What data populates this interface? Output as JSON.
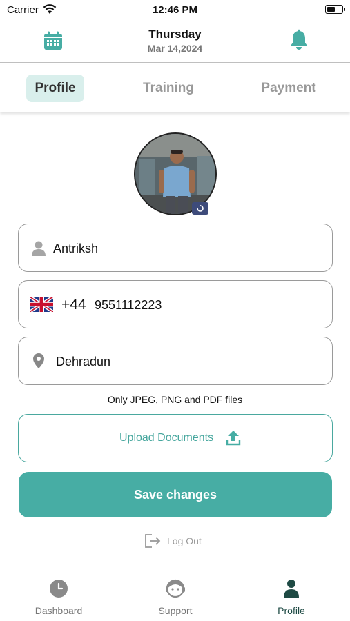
{
  "status_bar": {
    "carrier": "Carrier",
    "time": "12:46 PM"
  },
  "header": {
    "day": "Thursday",
    "date": "Mar 14,2024"
  },
  "tabs": [
    {
      "label": "Profile",
      "active": true
    },
    {
      "label": "Training",
      "active": false
    },
    {
      "label": "Payment",
      "active": false
    }
  ],
  "form": {
    "name": "Antriksh",
    "phone_code": "+44",
    "phone": "9551112223",
    "city": "Dehradun",
    "file_note": "Only JPEG, PNG and PDF files",
    "upload_label": "Upload Documents",
    "save_label": "Save changes",
    "logout_label": "Log Out"
  },
  "bottom_nav": [
    {
      "label": "Dashboard",
      "icon": "clock-icon",
      "active": false
    },
    {
      "label": "Support",
      "icon": "support-agent-icon",
      "active": false
    },
    {
      "label": "Profile",
      "icon": "person-icon",
      "active": true
    }
  ],
  "colors": {
    "accent": "#47ada4",
    "active_tab_bg": "#d9efec",
    "nav_active": "#1e4a44"
  }
}
